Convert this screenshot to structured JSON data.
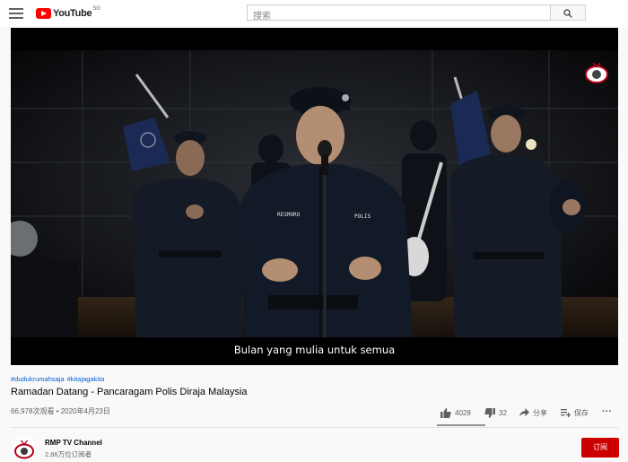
{
  "header": {
    "logo_text": "YouTube",
    "region": "SG",
    "search_placeholder": "搜索"
  },
  "video": {
    "subtitle": "Bulan yang mulia untuk semua",
    "name_tag_left": "RESMORO",
    "name_tag_right": "POLIS"
  },
  "details": {
    "hashtags": [
      "#dudukrumahsaja",
      "#kitajagakita"
    ],
    "title": "Ramadan Datang - Pancaragam Polis Diraja Malaysia",
    "views_date": "66,978次观看 • 2020年4月23日",
    "likes": "4028",
    "dislikes": "32",
    "share_label": "分享",
    "save_label": "保存",
    "more_label": "···"
  },
  "channel": {
    "name": "RMP TV Channel",
    "subscribers": "2.86万位订阅者",
    "subscribe_label": "订阅"
  },
  "colors": {
    "brand_red": "#ff0000",
    "subscribe_red": "#cc0000",
    "link_blue": "#065fd4"
  }
}
